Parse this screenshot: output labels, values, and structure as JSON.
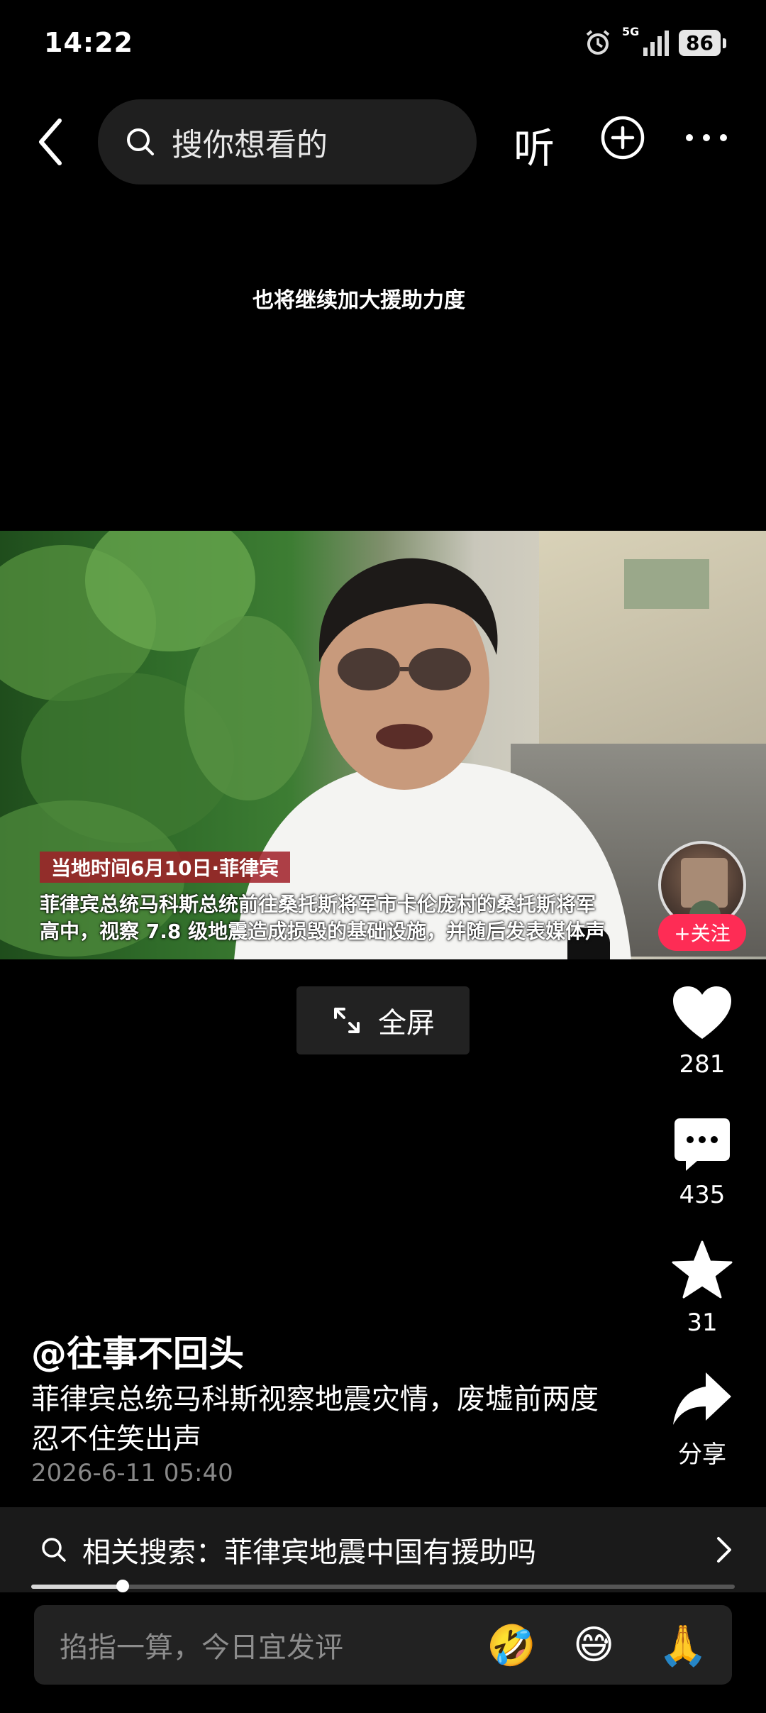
{
  "status_bar": {
    "time": "14:22",
    "network": "5G",
    "battery": "86"
  },
  "top_bar": {
    "search_placeholder": "搜你想看的",
    "listen_label": "听"
  },
  "video": {
    "caption_top": "也将继续加大援助力度",
    "location_tag": "当地时间6月10日·菲律宾",
    "subtitle_line1": "菲律宾总统马科斯总统前往桑托斯将军市卡伦庞村的桑托斯将军",
    "subtitle_line2": "高中，视察 7.8 级地震造成损毁的基础设施，并随后发表媒体声",
    "follow_label": "+关注"
  },
  "fullscreen_label": "全屏",
  "actions": {
    "like_count": "281",
    "comment_count": "435",
    "favorite_count": "31",
    "share_label": "分享"
  },
  "post": {
    "author": "@往事不回头",
    "description": "菲律宾总统马科斯视察地震灾情，废墟前两度忍不住笑出声",
    "date": "2026-6-11 05:40"
  },
  "related_search": {
    "text": "相关搜索：菲律宾地震中国有援助吗"
  },
  "playback": {
    "progress": 0.13
  },
  "comment_bar": {
    "placeholder": "掐指一算，今日宜发评",
    "emojis": [
      "🤣",
      "😅",
      "🙏"
    ]
  },
  "colors": {
    "follow": "#fe2c55",
    "background": "#000000"
  }
}
